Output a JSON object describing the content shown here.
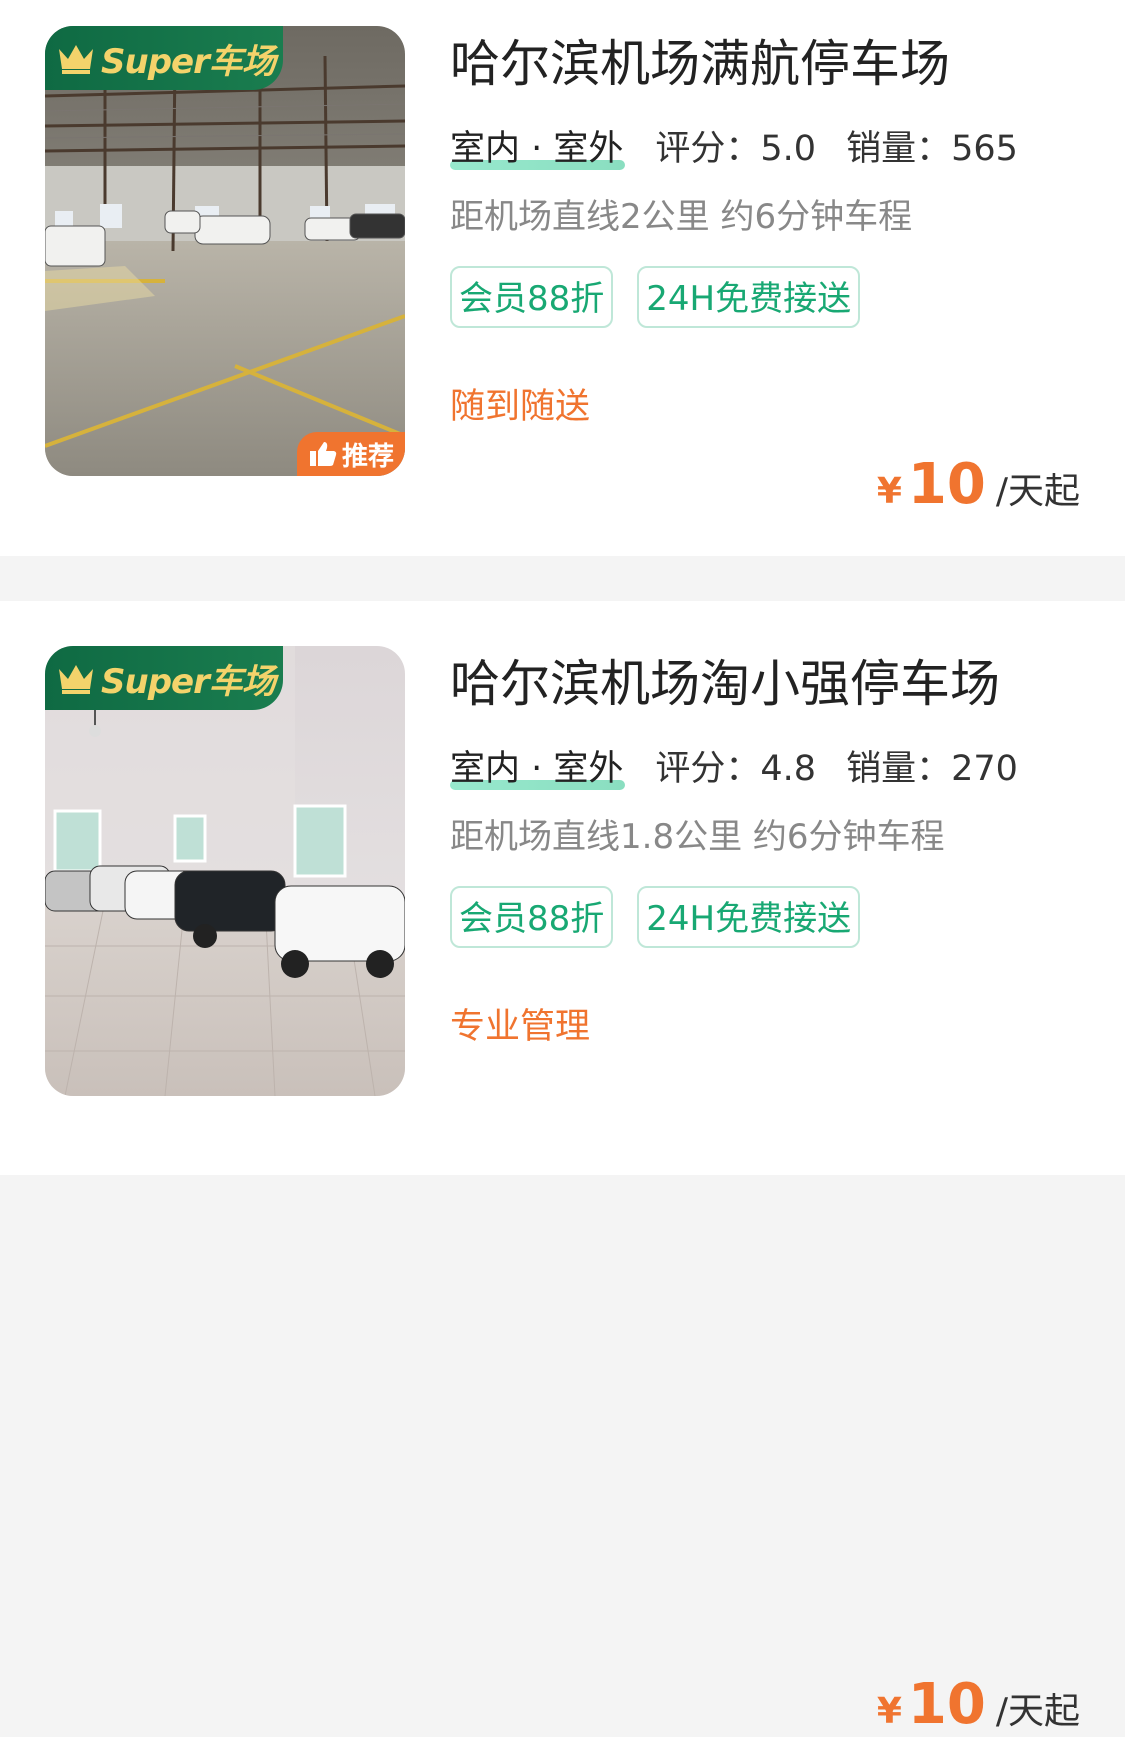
{
  "listings": [
    {
      "super_badge": "Super车场",
      "recommend_badge": "推荐",
      "name": "哈尔滨机场满航停车场",
      "env_type": "室内 · 室外",
      "score_label": "评分：5.0",
      "sales_label": "销量：565",
      "distance": "距机场直线2公里 约6分钟车程",
      "tags": [
        "会员88折",
        "24H免费接送"
      ],
      "feature": "随到随送",
      "price_symbol": "¥",
      "price": "10",
      "price_unit": "/天起"
    },
    {
      "super_badge": "Super车场",
      "name": "哈尔滨机场淘小强停车场",
      "env_type": "室内 · 室外",
      "score_label": "评分：4.8",
      "sales_label": "销量：270",
      "distance": "距机场直线1.8公里 约6分钟车程",
      "tags": [
        "会员88折",
        "24H免费接送"
      ],
      "feature": "专业管理",
      "price_symbol": "¥",
      "price": "10",
      "price_unit": "/天起"
    }
  ],
  "colors": {
    "accent_orange": "#f0742f",
    "tag_green": "#18a873",
    "badge_green": "#0f6a43",
    "badge_gold": "#f3d36b"
  },
  "icons": [
    "crown-icon",
    "thumbs-up-icon"
  ]
}
